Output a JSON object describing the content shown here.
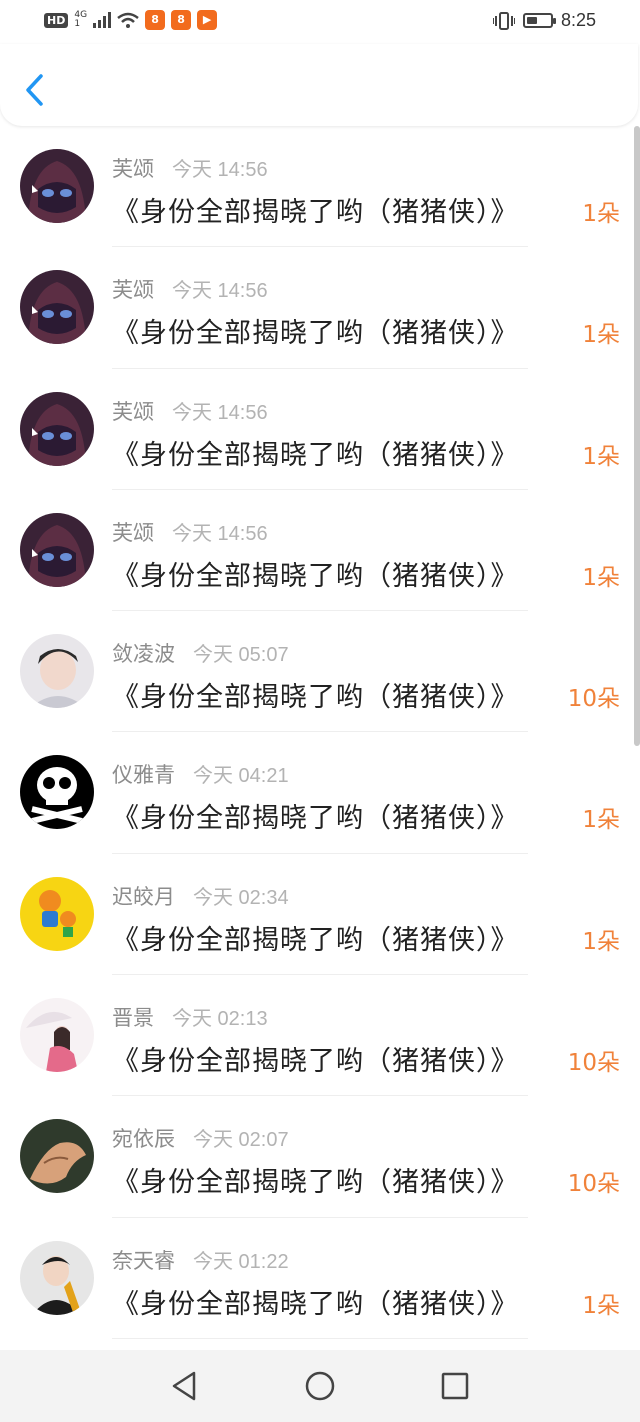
{
  "status_bar": {
    "hd": "HD",
    "network_top": "4G",
    "network_bottom": "1",
    "app_icons": [
      "a1-icon",
      "a2-icon",
      "video-icon"
    ],
    "time": "8:25",
    "battery_level": 0.45
  },
  "header": {
    "back_icon": "chevron-left-icon",
    "accent": "#2196f3"
  },
  "rows": [
    {
      "name": "芙颂",
      "time": "今天 14:56",
      "book": "《身份全部揭晓了哟（猪猪侠）》",
      "count": "1朵",
      "avatar": "anime-girl"
    },
    {
      "name": "芙颂",
      "time": "今天 14:56",
      "book": "《身份全部揭晓了哟（猪猪侠）》",
      "count": "1朵",
      "avatar": "anime-girl"
    },
    {
      "name": "芙颂",
      "time": "今天 14:56",
      "book": "《身份全部揭晓了哟（猪猪侠）》",
      "count": "1朵",
      "avatar": "anime-girl"
    },
    {
      "name": "芙颂",
      "time": "今天 14:56",
      "book": "《身份全部揭晓了哟（猪猪侠）》",
      "count": "1朵",
      "avatar": "anime-girl"
    },
    {
      "name": "敛凌波",
      "time": "今天 05:07",
      "book": "《身份全部揭晓了哟（猪猪侠）》",
      "count": "10朵",
      "avatar": "young-man"
    },
    {
      "name": "仪雅青",
      "time": "今天 04:21",
      "book": "《身份全部揭晓了哟（猪猪侠）》",
      "count": "1朵",
      "avatar": "skull"
    },
    {
      "name": "迟皎月",
      "time": "今天 02:34",
      "book": "《身份全部揭晓了哟（猪猪侠）》",
      "count": "1朵",
      "avatar": "orange-cartoon"
    },
    {
      "name": "晋景",
      "time": "今天 02:13",
      "book": "《身份全部揭晓了哟（猪猪侠）》",
      "count": "10朵",
      "avatar": "umbrella-girl"
    },
    {
      "name": "宛依辰",
      "time": "今天 02:07",
      "book": "《身份全部揭晓了哟（猪猪侠）》",
      "count": "10朵",
      "avatar": "hands"
    },
    {
      "name": "奈天睿",
      "time": "今天 01:22",
      "book": "《身份全部揭晓了哟（猪猪侠）》",
      "count": "1朵",
      "avatar": "man-suit"
    }
  ],
  "nav_bar": {
    "icons": [
      "back-triangle-icon",
      "home-circle-icon",
      "recents-square-icon"
    ]
  },
  "colors": {
    "count": "#f0823a",
    "name": "#8c8c8c",
    "time": "#b3b3b3",
    "book": "#222222"
  }
}
